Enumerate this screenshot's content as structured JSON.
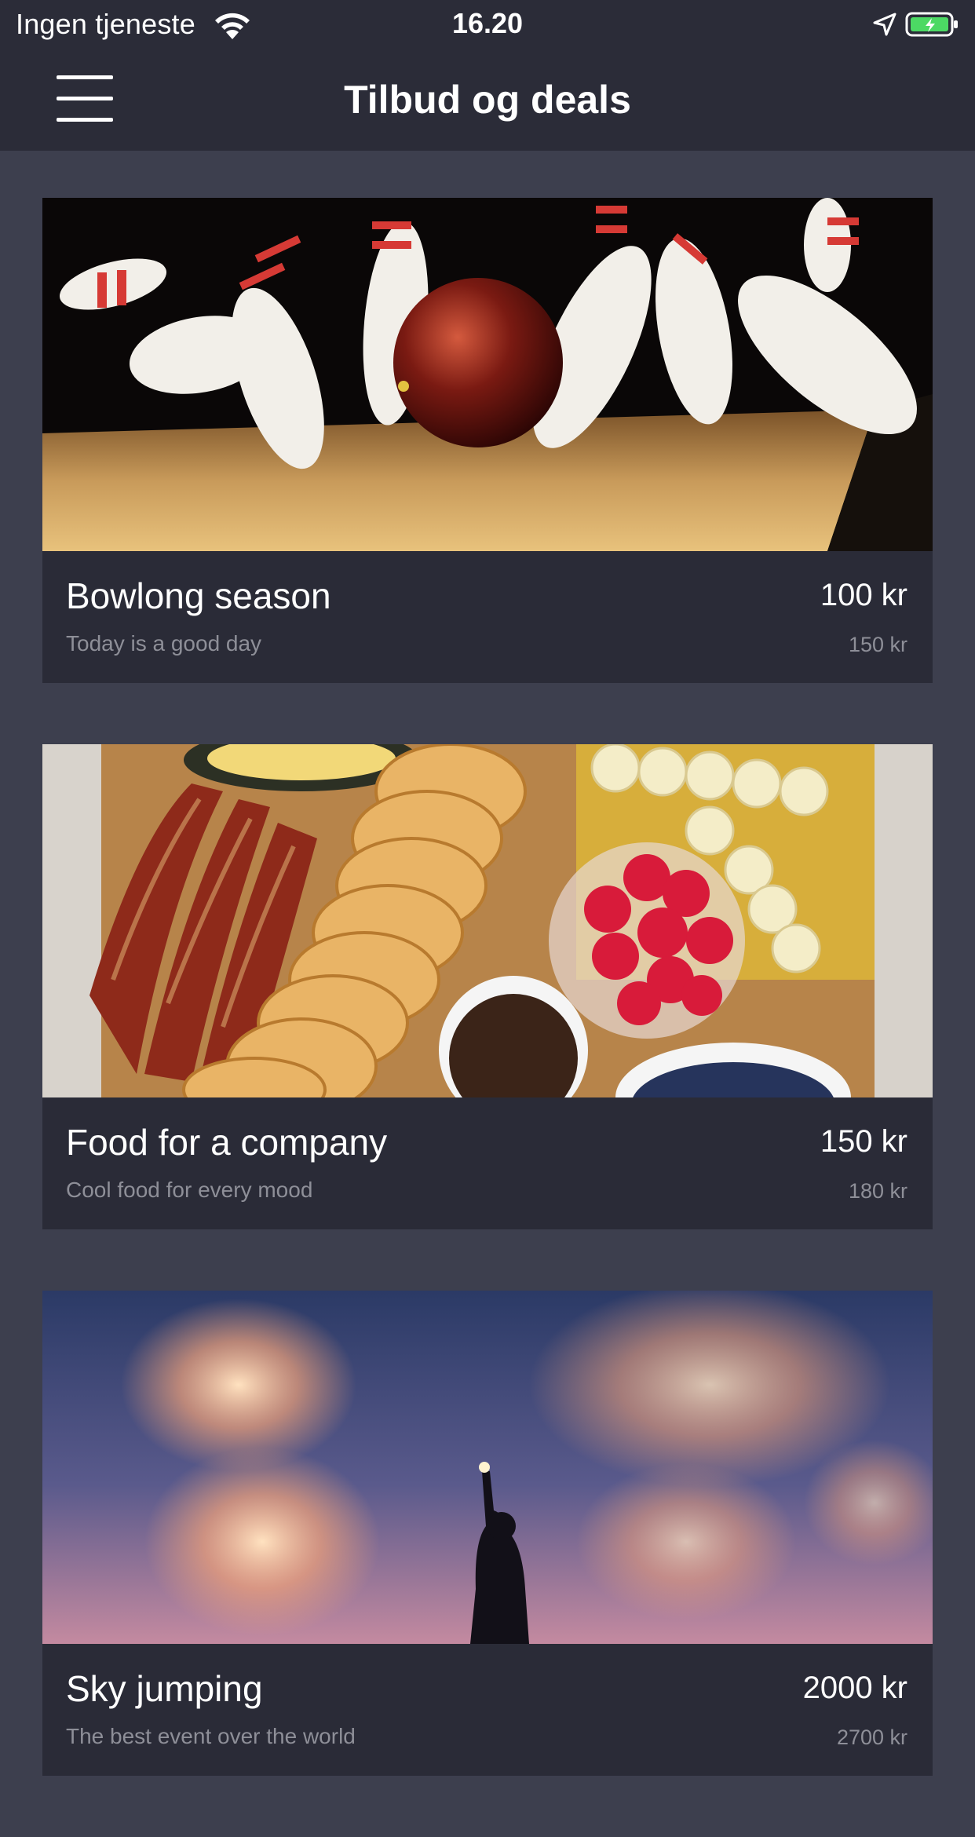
{
  "status_bar": {
    "carrier": "Ingen tjeneste",
    "time": "16.20",
    "battery_color": "#4cd964"
  },
  "header": {
    "title": "Tilbud og deals",
    "menu_icon": "hamburger-menu-icon"
  },
  "deals": [
    {
      "title": "Bowlong season",
      "subtitle": "Today is a good day",
      "price": "100 kr",
      "old_price": "150 kr",
      "image": "bowling-image"
    },
    {
      "title": "Food for a company",
      "subtitle": "Cool food for every mood",
      "price": "150 kr",
      "old_price": "180 kr",
      "image": "food-platter-image"
    },
    {
      "title": "Sky jumping",
      "subtitle": "The best event over the world",
      "price": "2000 kr",
      "old_price": "2700 kr",
      "image": "fireworks-image"
    }
  ],
  "colors": {
    "background": "#3d3f4e",
    "header": "#2b2c38",
    "card_body": "#2a2b37",
    "muted_text": "#8e8f98"
  }
}
